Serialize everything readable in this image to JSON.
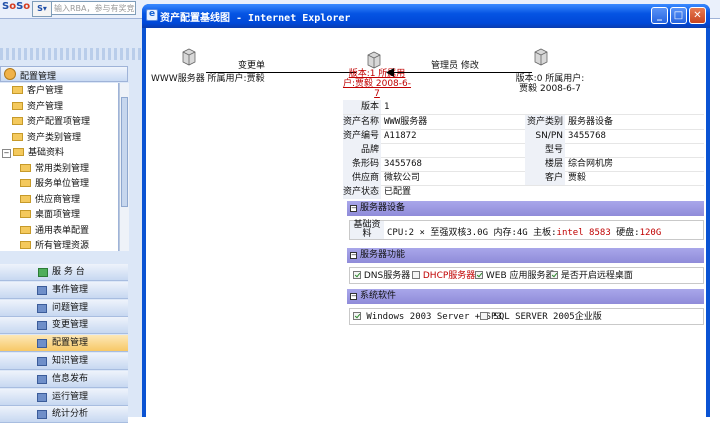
{
  "browser": {
    "search_placeholder": "输入RBA，参与有奖竞猜"
  },
  "sidebar": {
    "panel_title": "配置管理",
    "tree": [
      {
        "label": "客户管理",
        "level": 1
      },
      {
        "label": "资产管理",
        "level": 1
      },
      {
        "label": "资产配置项管理",
        "level": 1
      },
      {
        "label": "资产类别管理",
        "level": 1
      },
      {
        "label": "基础资料",
        "level": 0
      },
      {
        "label": "常用类别管理",
        "level": 2
      },
      {
        "label": "服务单位管理",
        "level": 2
      },
      {
        "label": "供应商管理",
        "level": 2
      },
      {
        "label": "桌面项管理",
        "level": 2
      },
      {
        "label": "通用表单配置",
        "level": 2
      },
      {
        "label": "所有管理资源",
        "level": 2
      }
    ],
    "nav": [
      {
        "label": "服 务 台",
        "icon": "service-desk-icon"
      },
      {
        "label": "事件管理",
        "icon": "incident-icon"
      },
      {
        "label": "问题管理",
        "icon": "problem-icon"
      },
      {
        "label": "变更管理",
        "icon": "change-icon"
      },
      {
        "label": "配置管理",
        "icon": "config-icon",
        "active": true
      },
      {
        "label": "知识管理",
        "icon": "knowledge-icon"
      },
      {
        "label": "信息发布",
        "icon": "publish-icon"
      },
      {
        "label": "运行管理",
        "icon": "operation-icon"
      },
      {
        "label": "统计分析",
        "icon": "stats-icon"
      }
    ]
  },
  "dialog": {
    "title": "资产配置基线图 - Internet Explorer",
    "graph": {
      "left_node": "WWW服务器 所属用户:贾毅",
      "left_edge": "变更单",
      "center_node": [
        "版本:1 所属用",
        "户:贾毅 2008-6-",
        "7"
      ],
      "right_edge": "管理员 修改",
      "right_node": [
        "版本:0 所属用户:",
        "贾毅 2008-6-7"
      ]
    },
    "info": {
      "version_label": "版本",
      "version_value": "1",
      "asset_name_label": "资产名称",
      "asset_name_value": "WWW服务器",
      "asset_cat_label": "资产类别",
      "asset_cat_value": "服务器设备",
      "asset_no_label": "资产编号",
      "asset_no_value": "A11872",
      "sn_label": "SN/PN",
      "sn_value": "3455768",
      "brand_label": "品牌",
      "brand_value": "",
      "model_label": "型号",
      "model_value": "",
      "barcode_label": "条形码",
      "barcode_value": "3455768",
      "location_label": "楼层",
      "location_value": "综合网机房",
      "supplier_label": "供应商",
      "supplier_value": "微软公司",
      "customer_label": "客户",
      "customer_value": "贾毅",
      "status_label": "资产状态",
      "status_value": "已配置"
    },
    "sections": {
      "hardware_title": "服务器设备",
      "hardware_label": "基础资料",
      "hardware_prefix": "CPU:2 × 至强双核3.0G 内存:4G 主板:",
      "hardware_board": "intel 8583",
      "hardware_disk_label": " 硬盘:",
      "hardware_disk": "120G",
      "function_title": "服务器功能",
      "functions": [
        {
          "label": "DNS服务器",
          "checked": true,
          "highlight": false
        },
        {
          "label": "DHCP服务器",
          "checked": false,
          "highlight": true
        },
        {
          "label": "WEB 应用服务器",
          "checked": true,
          "highlight": false
        },
        {
          "label": "是否开启远程桌面",
          "checked": true,
          "highlight": false
        }
      ],
      "software_title": "系统软件",
      "software": [
        {
          "label": "Windows 2003 Server + SP3",
          "checked": true
        },
        {
          "label": "SQL SERVER 2005企业版",
          "checked": false
        }
      ]
    }
  }
}
